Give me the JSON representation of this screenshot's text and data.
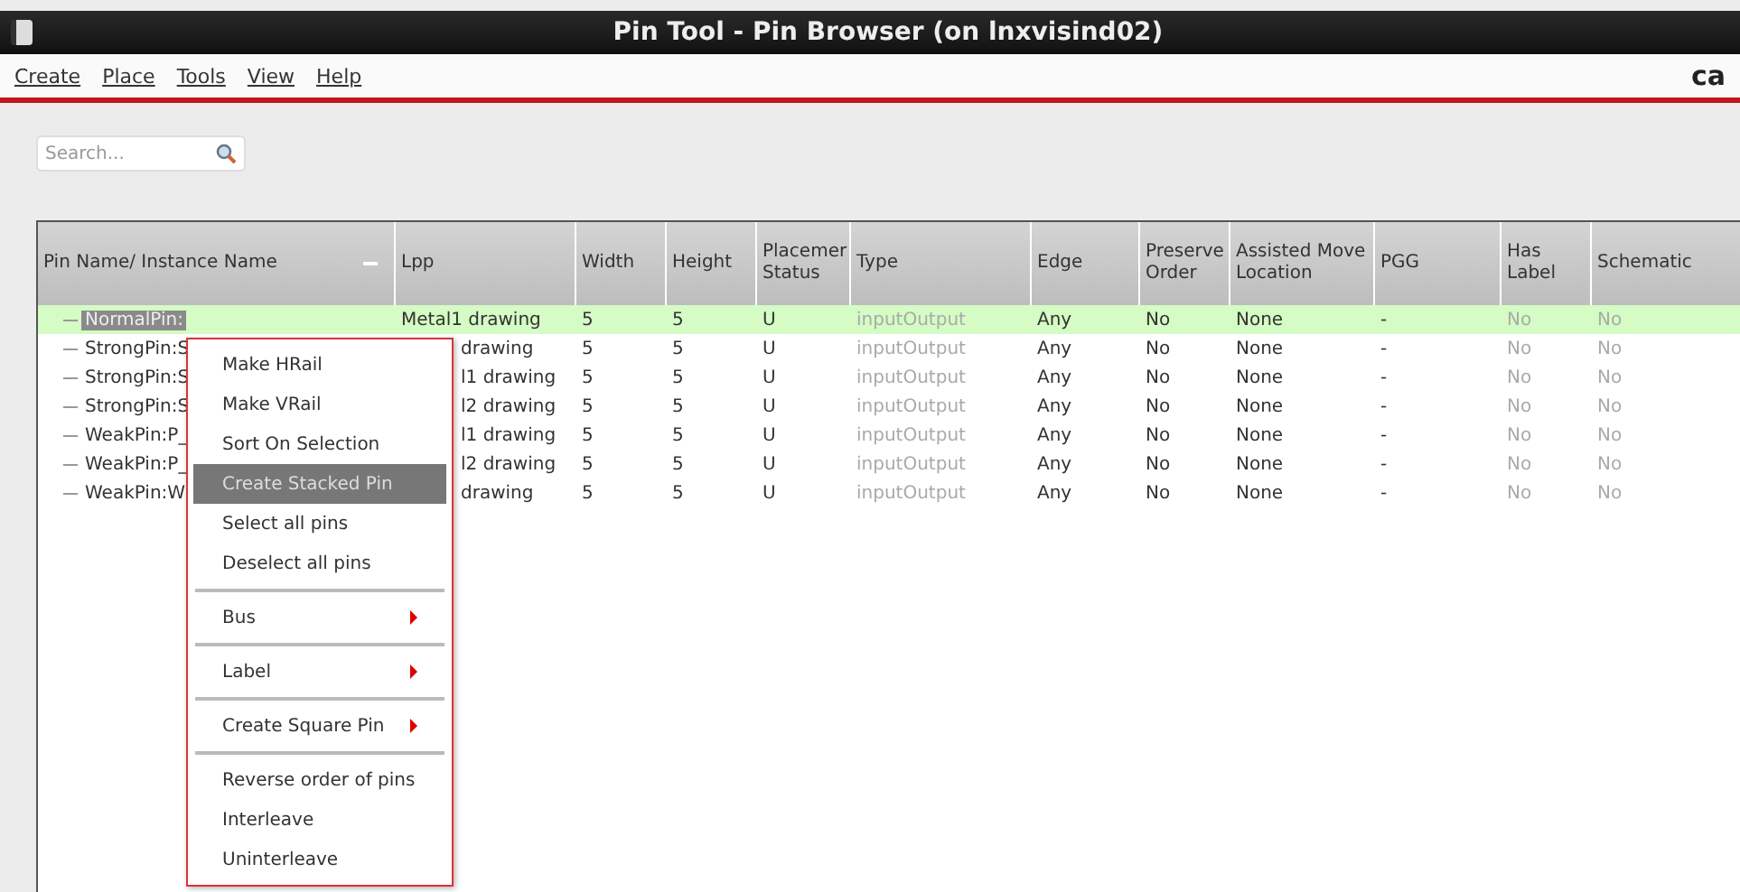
{
  "window": {
    "title": "Pin Tool - Pin Browser (on lnxvisind02)"
  },
  "menubar": {
    "items": [
      "Create",
      "Place",
      "Tools",
      "View",
      "Help"
    ],
    "logo": "ca"
  },
  "search": {
    "placeholder": "Search..."
  },
  "table": {
    "columns": [
      "Pin Name/ Instance Name",
      "Lpp",
      "Width",
      "Height",
      "Placemer Status",
      "Type",
      "Edge",
      "Preserve Order",
      "Assisted Move Location",
      "PGG",
      "Has Label",
      "Schematic"
    ],
    "rows": [
      {
        "selected": true,
        "cells": [
          "NormalPin:",
          "Metal1 drawing",
          "5",
          "5",
          "U",
          "inputOutput",
          "Any",
          "No",
          "None",
          "-",
          "No",
          "No"
        ]
      },
      {
        "selected": false,
        "cells": [
          "StrongPin:S",
          "drawing",
          "5",
          "5",
          "U",
          "inputOutput",
          "Any",
          "No",
          "None",
          "-",
          "No",
          "No"
        ]
      },
      {
        "selected": false,
        "cells": [
          "StrongPin:S",
          "l1 drawing",
          "5",
          "5",
          "U",
          "inputOutput",
          "Any",
          "No",
          "None",
          "-",
          "No",
          "No"
        ]
      },
      {
        "selected": false,
        "cells": [
          "StrongPin:S",
          "l2 drawing",
          "5",
          "5",
          "U",
          "inputOutput",
          "Any",
          "No",
          "None",
          "-",
          "No",
          "No"
        ]
      },
      {
        "selected": false,
        "cells": [
          "WeakPin:P_",
          "l1 drawing",
          "5",
          "5",
          "U",
          "inputOutput",
          "Any",
          "No",
          "None",
          "-",
          "No",
          "No"
        ]
      },
      {
        "selected": false,
        "cells": [
          "WeakPin:P_",
          "l2 drawing",
          "5",
          "5",
          "U",
          "inputOutput",
          "Any",
          "No",
          "None",
          "-",
          "No",
          "No"
        ]
      },
      {
        "selected": false,
        "cells": [
          "WeakPin:W",
          "drawing",
          "5",
          "5",
          "U",
          "inputOutput",
          "Any",
          "No",
          "None",
          "-",
          "No",
          "No"
        ]
      }
    ]
  },
  "context_menu": {
    "groups": [
      [
        {
          "label": "Make HRail",
          "selected": false,
          "submenu": false
        },
        {
          "label": "Make VRail",
          "selected": false,
          "submenu": false
        },
        {
          "label": "Sort On Selection",
          "selected": false,
          "submenu": false
        },
        {
          "label": "Create Stacked Pin",
          "selected": true,
          "submenu": false
        },
        {
          "label": "Select all pins",
          "selected": false,
          "submenu": false
        },
        {
          "label": "Deselect all pins",
          "selected": false,
          "submenu": false
        }
      ],
      [
        {
          "label": "Bus",
          "selected": false,
          "submenu": true
        }
      ],
      [
        {
          "label": "Label",
          "selected": false,
          "submenu": true
        }
      ],
      [
        {
          "label": "Create Square Pin",
          "selected": false,
          "submenu": true
        }
      ],
      [
        {
          "label": "Reverse order of pins",
          "selected": false,
          "submenu": false
        },
        {
          "label": "Interleave",
          "selected": false,
          "submenu": false
        },
        {
          "label": "Uninterleave",
          "selected": false,
          "submenu": false
        }
      ]
    ]
  }
}
